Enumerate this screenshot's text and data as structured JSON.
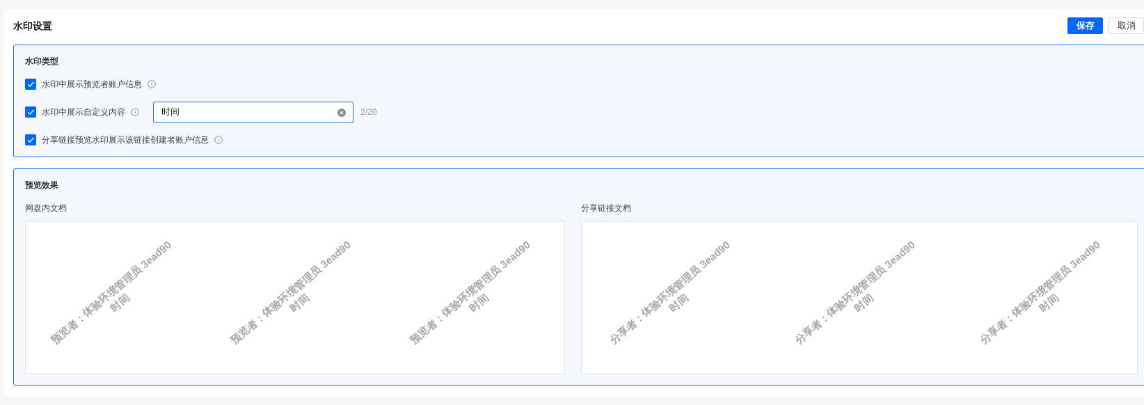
{
  "page": {
    "title": "水印设置"
  },
  "buttons": [
    {
      "label": "保存",
      "kind": "primary"
    },
    {
      "label": "取消",
      "kind": "secondary"
    }
  ],
  "watermark_type": {
    "title": "水印类型",
    "options": [
      {
        "label": "水印中展示预览者账户信息",
        "checked": true
      },
      {
        "label": "水印中展示自定义内容",
        "checked": true,
        "input": {
          "value": "时间",
          "counter": "2/20"
        }
      },
      {
        "label": "分享链接预览水印展示该链接创建者账户信息",
        "checked": true
      }
    ]
  },
  "preview": {
    "title": "预览效果",
    "panels": [
      {
        "label": "网盘内文档",
        "tiles": [
          {
            "lines": [
              "预览者：体验环境管理员 3ead90",
              "时间"
            ]
          },
          {
            "lines": [
              "预览者：体验环境管理员 3ead90",
              "时间"
            ]
          },
          {
            "lines": [
              "预览者：体验环境管理员 3ead90",
              "时间"
            ]
          }
        ]
      },
      {
        "label": "分享链接文档",
        "tiles": [
          {
            "lines": [
              "分享者：体验环境管理员 3ead90",
              "时间"
            ]
          },
          {
            "lines": [
              "分享者：体验环境管理员 3ead90",
              "时间"
            ]
          },
          {
            "lines": [
              "分享者：体验环境管理员 3ead90",
              "时间"
            ]
          }
        ]
      }
    ]
  }
}
